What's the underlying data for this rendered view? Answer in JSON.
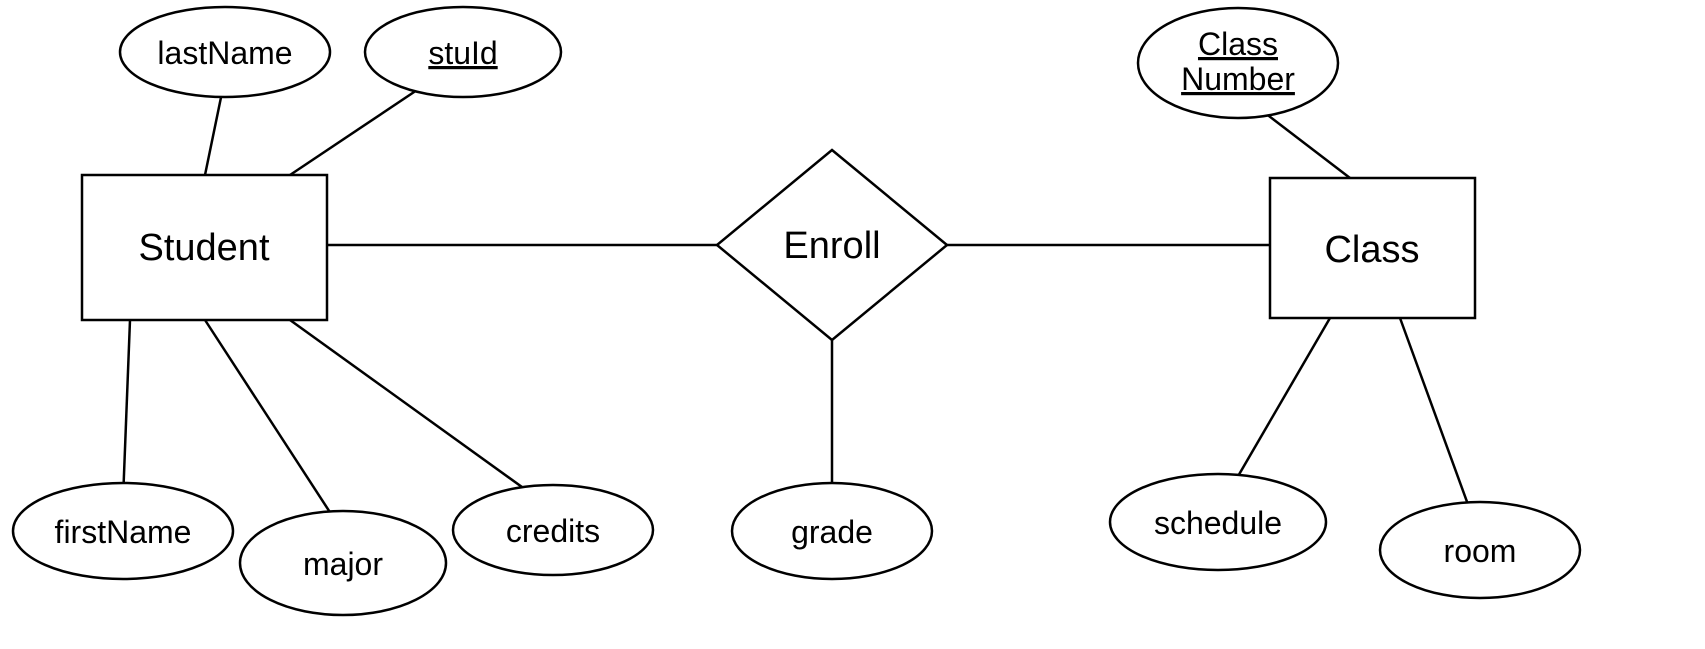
{
  "entities": {
    "student": {
      "label": "Student"
    },
    "class": {
      "label": "Class"
    }
  },
  "relationships": {
    "enroll": {
      "label": "Enroll"
    }
  },
  "attributes": {
    "lastName": {
      "label": "lastName",
      "isKey": false
    },
    "stuId": {
      "label": "stuId",
      "isKey": true
    },
    "firstName": {
      "label": "firstName",
      "isKey": false
    },
    "major": {
      "label": "major",
      "isKey": false
    },
    "credits": {
      "label": "credits",
      "isKey": false
    },
    "grade": {
      "label": "grade",
      "isKey": false
    },
    "classNumber": {
      "label_line1": "Class",
      "label_line2": "Number",
      "isKey": true
    },
    "schedule": {
      "label": "schedule",
      "isKey": false
    },
    "room": {
      "label": "room",
      "isKey": false
    }
  }
}
